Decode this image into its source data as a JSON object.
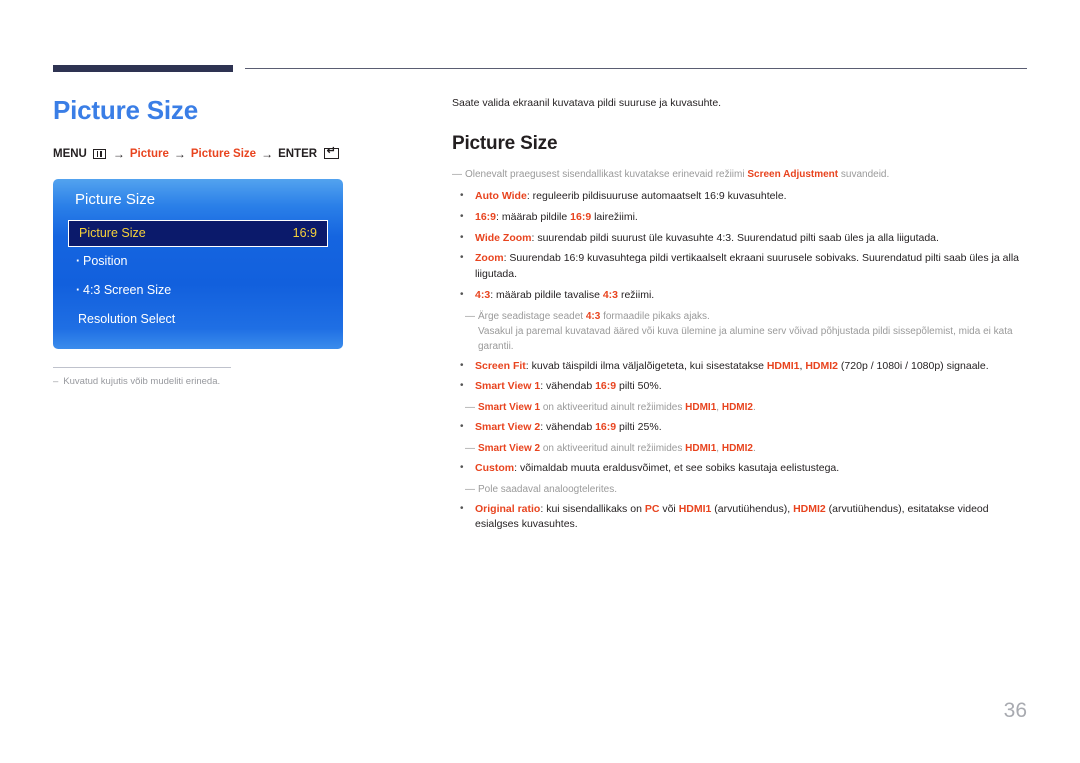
{
  "document": {
    "page_number": "36"
  },
  "left": {
    "page_title": "Picture Size",
    "menu_path": {
      "menu_label": "MENU",
      "menu_icon": "menu-grid-icon",
      "arrow": "→",
      "step1": "Picture",
      "step2": "Picture Size",
      "enter_label": "ENTER",
      "enter_icon": "enter-key-icon"
    },
    "osd": {
      "title": "Picture Size",
      "rows": [
        {
          "label": "Picture Size",
          "value": "16:9",
          "selected": true,
          "sub": false
        },
        {
          "label": "Position",
          "value": "",
          "selected": false,
          "sub": true
        },
        {
          "label": "4:3 Screen Size",
          "value": "",
          "selected": false,
          "sub": true
        },
        {
          "label": "Resolution Select",
          "value": "",
          "selected": false,
          "sub": false
        }
      ]
    },
    "footnote": {
      "dash": "–",
      "text": "Kuvatud kujutis võib mudeliti erineda."
    }
  },
  "right": {
    "intro": "Saate valida ekraanil kuvatava pildi suuruse ja kuvasuhte.",
    "section_head": "Picture Size",
    "top_note": {
      "dash": "—",
      "prefix": "Olenevalt praegusest sisendallikast kuvatakse erinevaid režiimi ",
      "bold": "Screen Adjustment",
      "suffix": " suvandeid."
    },
    "items": [
      {
        "id": "auto-wide",
        "term": "Auto Wide",
        "sep": ": ",
        "body": "reguleerib pildisuuruse automaatselt 16:9 kuvasuhtele."
      },
      {
        "id": "16-9",
        "term": "16:9",
        "sep": ": ",
        "body_pre": "määrab pildile ",
        "body_bold": "16:9",
        "body_post": " lairežiimi."
      },
      {
        "id": "wide-zoom",
        "term": "Wide Zoom",
        "sep": ": ",
        "body": "suurendab pildi suurust üle kuvasuhte 4:3. Suurendatud pilti saab üles ja alla liigutada."
      },
      {
        "id": "zoom",
        "term": "Zoom",
        "sep": ": ",
        "body": "Suurendab 16:9 kuvasuhtega pildi vertikaalselt ekraani suurusele sobivaks. Suurendatud pilti saab üles ja alla liigutada."
      },
      {
        "id": "4-3",
        "term": "4:3",
        "sep": ": ",
        "body_pre": "määrab pildile tavalise ",
        "body_bold": "4:3",
        "body_post": " režiimi."
      }
    ],
    "note_43": {
      "dash": "—",
      "line1_pre": "Ärge seadistage seadet ",
      "line1_bold": "4:3",
      "line1_post": " formaadile pikaks ajaks.",
      "line2": "Vasakul ja paremal kuvatavad ääred või kuva ülemine ja alumine serv võivad põhjustada pildi sissepõlemist, mida ei kata garantii."
    },
    "items2": [
      {
        "id": "screen-fit",
        "term": "Screen Fit",
        "sep": ": ",
        "pre": "kuvab täispildi ilma väljalõigeteta, kui sisestatakse ",
        "b1": "HDMI1",
        "mid": ", ",
        "b2": "HDMI2",
        "post": " (720p / 1080i / 1080p) signaale."
      },
      {
        "id": "smart-view-1",
        "term": "Smart View 1",
        "sep": ": ",
        "pre": "vähendab ",
        "b1": "16:9",
        "post": " pilti 50%."
      }
    ],
    "note_sv1": {
      "dash": "—",
      "bold": "Smart View 1",
      "mid": " on aktiveeritud ainult režiimides ",
      "b1": "HDMI1",
      "sep": ", ",
      "b2": "HDMI2",
      "post": "."
    },
    "item_sv2": {
      "id": "smart-view-2",
      "term": "Smart View 2",
      "sep": ": ",
      "pre": "vähendab ",
      "b1": "16:9",
      "post": " pilti 25%."
    },
    "note_sv2": {
      "dash": "—",
      "bold": "Smart View 2",
      "mid": " on aktiveeritud ainult režiimides ",
      "b1": "HDMI1",
      "sep": ", ",
      "b2": "HDMI2",
      "post": "."
    },
    "item_custom": {
      "id": "custom",
      "term": "Custom",
      "sep": ": ",
      "body": "võimaldab muuta eraldusvõimet, et see sobiks kasutaja eelistustega."
    },
    "note_custom": {
      "dash": "—",
      "text": "Pole saadaval analoogtelerites."
    },
    "item_original": {
      "id": "original-ratio",
      "term": "Original ratio",
      "sep": ": ",
      "pre": "kui sisendallikaks on ",
      "b1": "PC",
      "mid1": " või ",
      "b2": "HDMI1",
      "mid2": " (arvutiühendus), ",
      "b3": "HDMI2",
      "post": " (arvutiühendus), esitatakse videod esialgses kuvasuhtes."
    }
  },
  "colors": {
    "accent_red": "#e8441f",
    "title_blue": "#3a7ee6",
    "rule_navy": "#2e3352",
    "osd_highlight": "#0b1a6b",
    "osd_value_gold": "#f6d13a",
    "note_gray": "#9a9a9a"
  }
}
